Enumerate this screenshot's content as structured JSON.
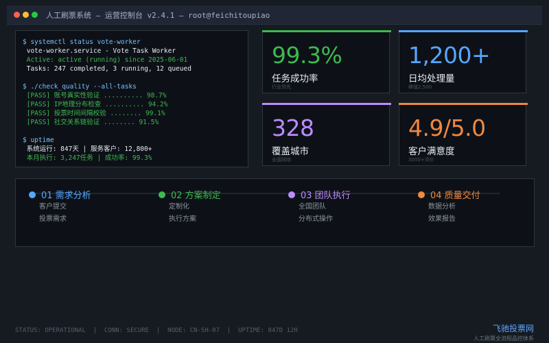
{
  "window": {
    "title": "人工刷票系统 — 运营控制台 v2.4.1 — root@feichitoupiao",
    "controls": {
      "close_color": "#ff5f56",
      "minimize_color": "#ffbd2e",
      "maximize_color": "#27c93f"
    }
  },
  "terminal": {
    "lines": [
      {
        "text": "$ systemctl status vote-worker",
        "style": "cmd"
      },
      {
        "text": " vote-worker.service - Vote Task Worker",
        "style": "white"
      },
      {
        "text": " Active: active (running) since 2025-06-01",
        "style": "green"
      },
      {
        "text": " Tasks: 247 completed, 3 running, 12 queued",
        "style": "white"
      },
      {
        "text": "",
        "style": "gap"
      },
      {
        "text": "$ ./check_quality --all-tasks",
        "style": "cmd"
      },
      {
        "text": " [PASS] 账号真实性验证 .......... 98.7%",
        "style": "green"
      },
      {
        "text": " [PASS] IP地理分布检查 .......... 94.2%",
        "style": "green"
      },
      {
        "text": " [PASS] 投票时间间隔校验 ........ 99.1%",
        "style": "green"
      },
      {
        "text": " [PASS] 社交关系链验证 ........ 91.5%",
        "style": "green"
      },
      {
        "text": "",
        "style": "gap"
      },
      {
        "text": "$ uptime",
        "style": "cmd"
      },
      {
        "text": " 系统运行: 847天 | 服务客户: 12,800+",
        "style": "white"
      },
      {
        "text": " 本月执行: 3,247任务 | 成功率: 99.3%",
        "style": "green"
      }
    ]
  },
  "stats": [
    {
      "value": "99.3%",
      "label": "任务成功率",
      "sub": "行业领先",
      "color": "#3fb950"
    },
    {
      "value": "1,200+",
      "label": "日均处理量",
      "sub": "峰值2,500",
      "color": "#58a6ff"
    },
    {
      "value": "328",
      "label": "覆盖城市",
      "sub": "全国网络",
      "color": "#bc8cff"
    },
    {
      "value": "4.9/5.0",
      "label": "客户满意度",
      "sub": "3000+评价",
      "color": "#f0883e"
    }
  ],
  "process": {
    "steps": [
      {
        "title": "01 需求分析",
        "items": [
          "客户提交",
          "投票需求"
        ],
        "color": "#58a6ff"
      },
      {
        "title": "02 方案制定",
        "items": [
          "定制化",
          "执行方案"
        ],
        "color": "#3fb950"
      },
      {
        "title": "03 团队执行",
        "items": [
          "全国团队",
          "分布式操作"
        ],
        "color": "#bc8cff"
      },
      {
        "title": "04 质量交付",
        "items": [
          "数据分析",
          "效果报告"
        ],
        "color": "#f0883e"
      }
    ]
  },
  "statusbar": {
    "text": "STATUS: OPERATIONAL  |  CONN: SECURE  |  NODE: CN-SH-07  |  UPTIME: 847D 12H"
  },
  "brand": {
    "name": "飞驰投票网",
    "tagline": "人工刷票全流程品控体系"
  }
}
